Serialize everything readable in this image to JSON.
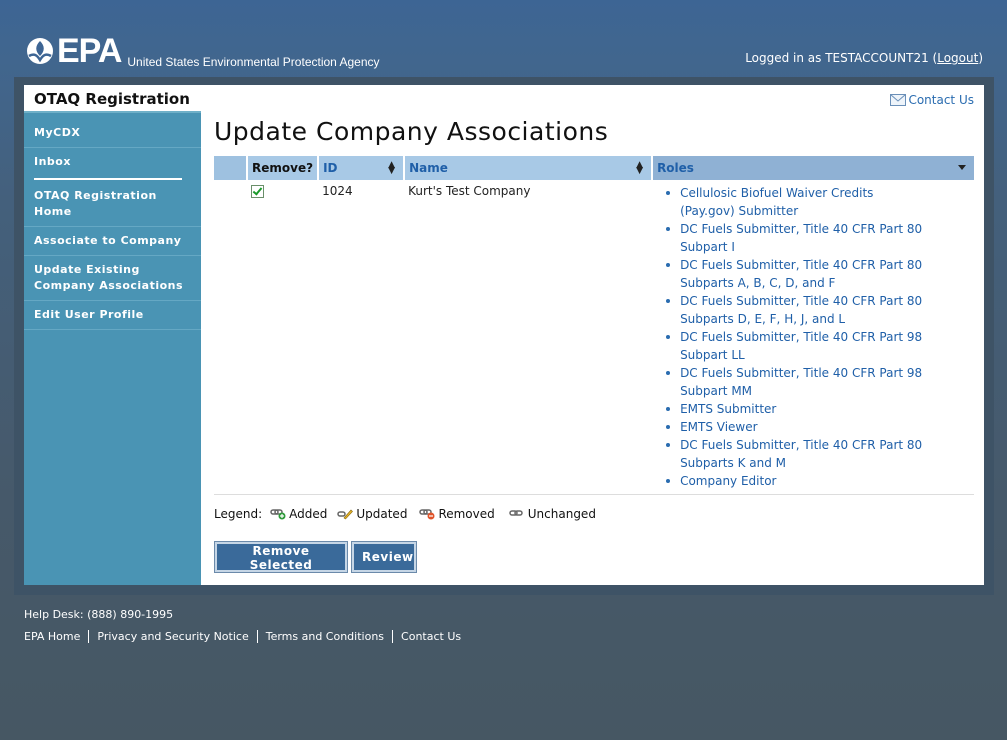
{
  "header": {
    "logo_text": "EPA",
    "agency_name": "United States Environmental Protection Agency",
    "logged_in_prefix": "Logged in as TESTACCOUNT21 (",
    "logout_label": "Logout",
    "logged_in_suffix": ")"
  },
  "sidebar": {
    "title": "OTAQ Registration",
    "items": [
      {
        "label": "MyCDX"
      },
      {
        "label": "Inbox"
      },
      {
        "label": "OTAQ Registration Home"
      },
      {
        "label": "Associate to Company"
      },
      {
        "label": "Update Existing Company Associations"
      },
      {
        "label": "Edit User Profile"
      }
    ]
  },
  "main": {
    "contact_label": "Contact Us",
    "title": "Update Company Associations",
    "table": {
      "columns": {
        "remove": "Remove?",
        "id": "ID",
        "name": "Name",
        "roles": "Roles"
      },
      "rows": [
        {
          "checked": true,
          "id": "1024",
          "name": "Kurt's Test Company",
          "roles": [
            "Cellulosic Biofuel Waiver Credits (Pay.gov) Submitter",
            "DC Fuels Submitter, Title 40 CFR Part 80 Subpart I",
            "DC Fuels Submitter, Title 40 CFR Part 80 Subparts A, B, C, D, and F",
            "DC Fuels Submitter, Title 40 CFR Part 80 Subparts D, E, F, H, J, and L",
            "DC Fuels Submitter, Title 40 CFR Part 98 Subpart LL",
            "DC Fuels Submitter, Title 40 CFR Part 98 Subpart MM",
            "EMTS Submitter",
            "EMTS Viewer",
            "DC Fuels Submitter, Title 40 CFR Part 80 Subparts K and M",
            "Company Editor"
          ]
        }
      ]
    },
    "legend": {
      "label": "Legend:",
      "added": "Added",
      "updated": "Updated",
      "removed": "Removed",
      "unchanged": "Unchanged"
    },
    "buttons": {
      "remove_selected": "Remove Selected",
      "review": "Review"
    }
  },
  "footer": {
    "help_desk": "Help Desk: (888) 890-1995",
    "links": [
      "EPA Home",
      "Privacy and Security Notice",
      "Terms and Conditions",
      "Contact Us"
    ]
  },
  "colors": {
    "brand_blue": "#3d6594",
    "sidebar": "#4a94b4",
    "link": "#1f5fa8",
    "header_row": "#a8c9e6"
  }
}
